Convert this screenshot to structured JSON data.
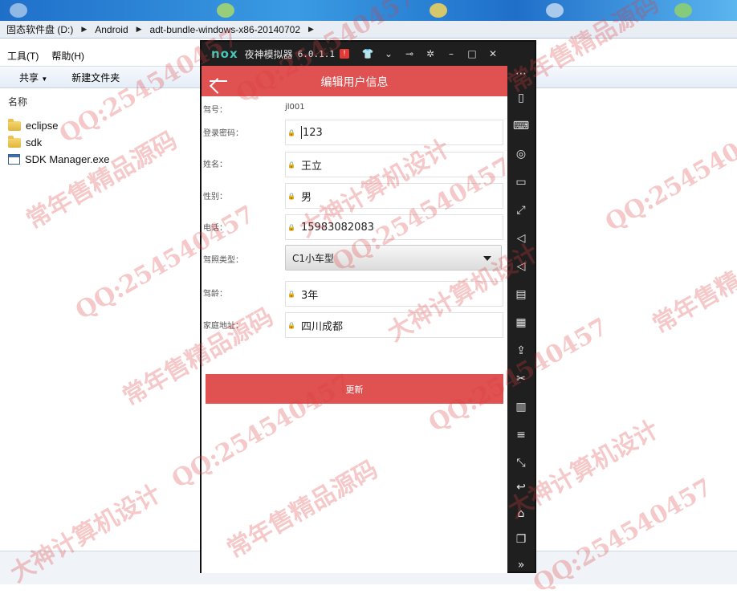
{
  "explorer": {
    "breadcrumb": [
      "固态软件盘 (D:)",
      "Android",
      "adt-bundle-windows-x86-20140702"
    ],
    "menu": [
      "工具(T)",
      "帮助(H)"
    ],
    "toolbar": {
      "share": "共享",
      "new_folder": "新建文件夹"
    },
    "column_name": "名称",
    "files": [
      {
        "name": "eclipse",
        "type": "folder"
      },
      {
        "name": "sdk",
        "type": "folder"
      },
      {
        "name": "SDK Manager.exe",
        "type": "exe"
      }
    ]
  },
  "emulator": {
    "logo": "nox",
    "name": "夜神模拟器",
    "version": "6.0.1.1",
    "alert": "!",
    "title_buttons": [
      "shirt-icon",
      "chevron-down-icon",
      "pin-icon",
      "gear-icon",
      "minimize-icon",
      "maximize-icon",
      "close-icon"
    ],
    "sidebar_icons": [
      "more-icon",
      "phone-shake-icon",
      "keyboard-icon",
      "location-icon",
      "screen-icon",
      "fullscreen-icon",
      "volume-up-icon",
      "volume-down-icon",
      "install-icon",
      "record-icon",
      "apk-icon",
      "scissors-icon",
      "multi-instance-icon",
      "menu-icon",
      "resize-icon",
      "back-icon",
      "home-icon",
      "recents-icon",
      "expand-icon"
    ]
  },
  "app": {
    "title": "编辑用户信息",
    "fields": {
      "account": {
        "label": "驾号：",
        "value": "jl001"
      },
      "password": {
        "label": "登录密码：",
        "value": "123"
      },
      "name": {
        "label": "姓名：",
        "value": "王立"
      },
      "gender": {
        "label": "性别：",
        "value": "男"
      },
      "phone": {
        "label": "电话：",
        "value": "15983082083"
      },
      "license_type": {
        "label": "驾照类型：",
        "value": "C1小车型"
      },
      "driving_age": {
        "label": "驾龄：",
        "value": "3年"
      },
      "address": {
        "label": "家庭地址：",
        "value": "四川成都"
      }
    },
    "update_button": "更新"
  },
  "watermark": {
    "qq": "QQ:254540457",
    "shop": "常年售精品源码",
    "design": "大神计算机设计"
  },
  "colors": {
    "appbar": "#e05151",
    "emulator_bg": "#1f1f1f",
    "nox_accent": "#48c7b6"
  }
}
